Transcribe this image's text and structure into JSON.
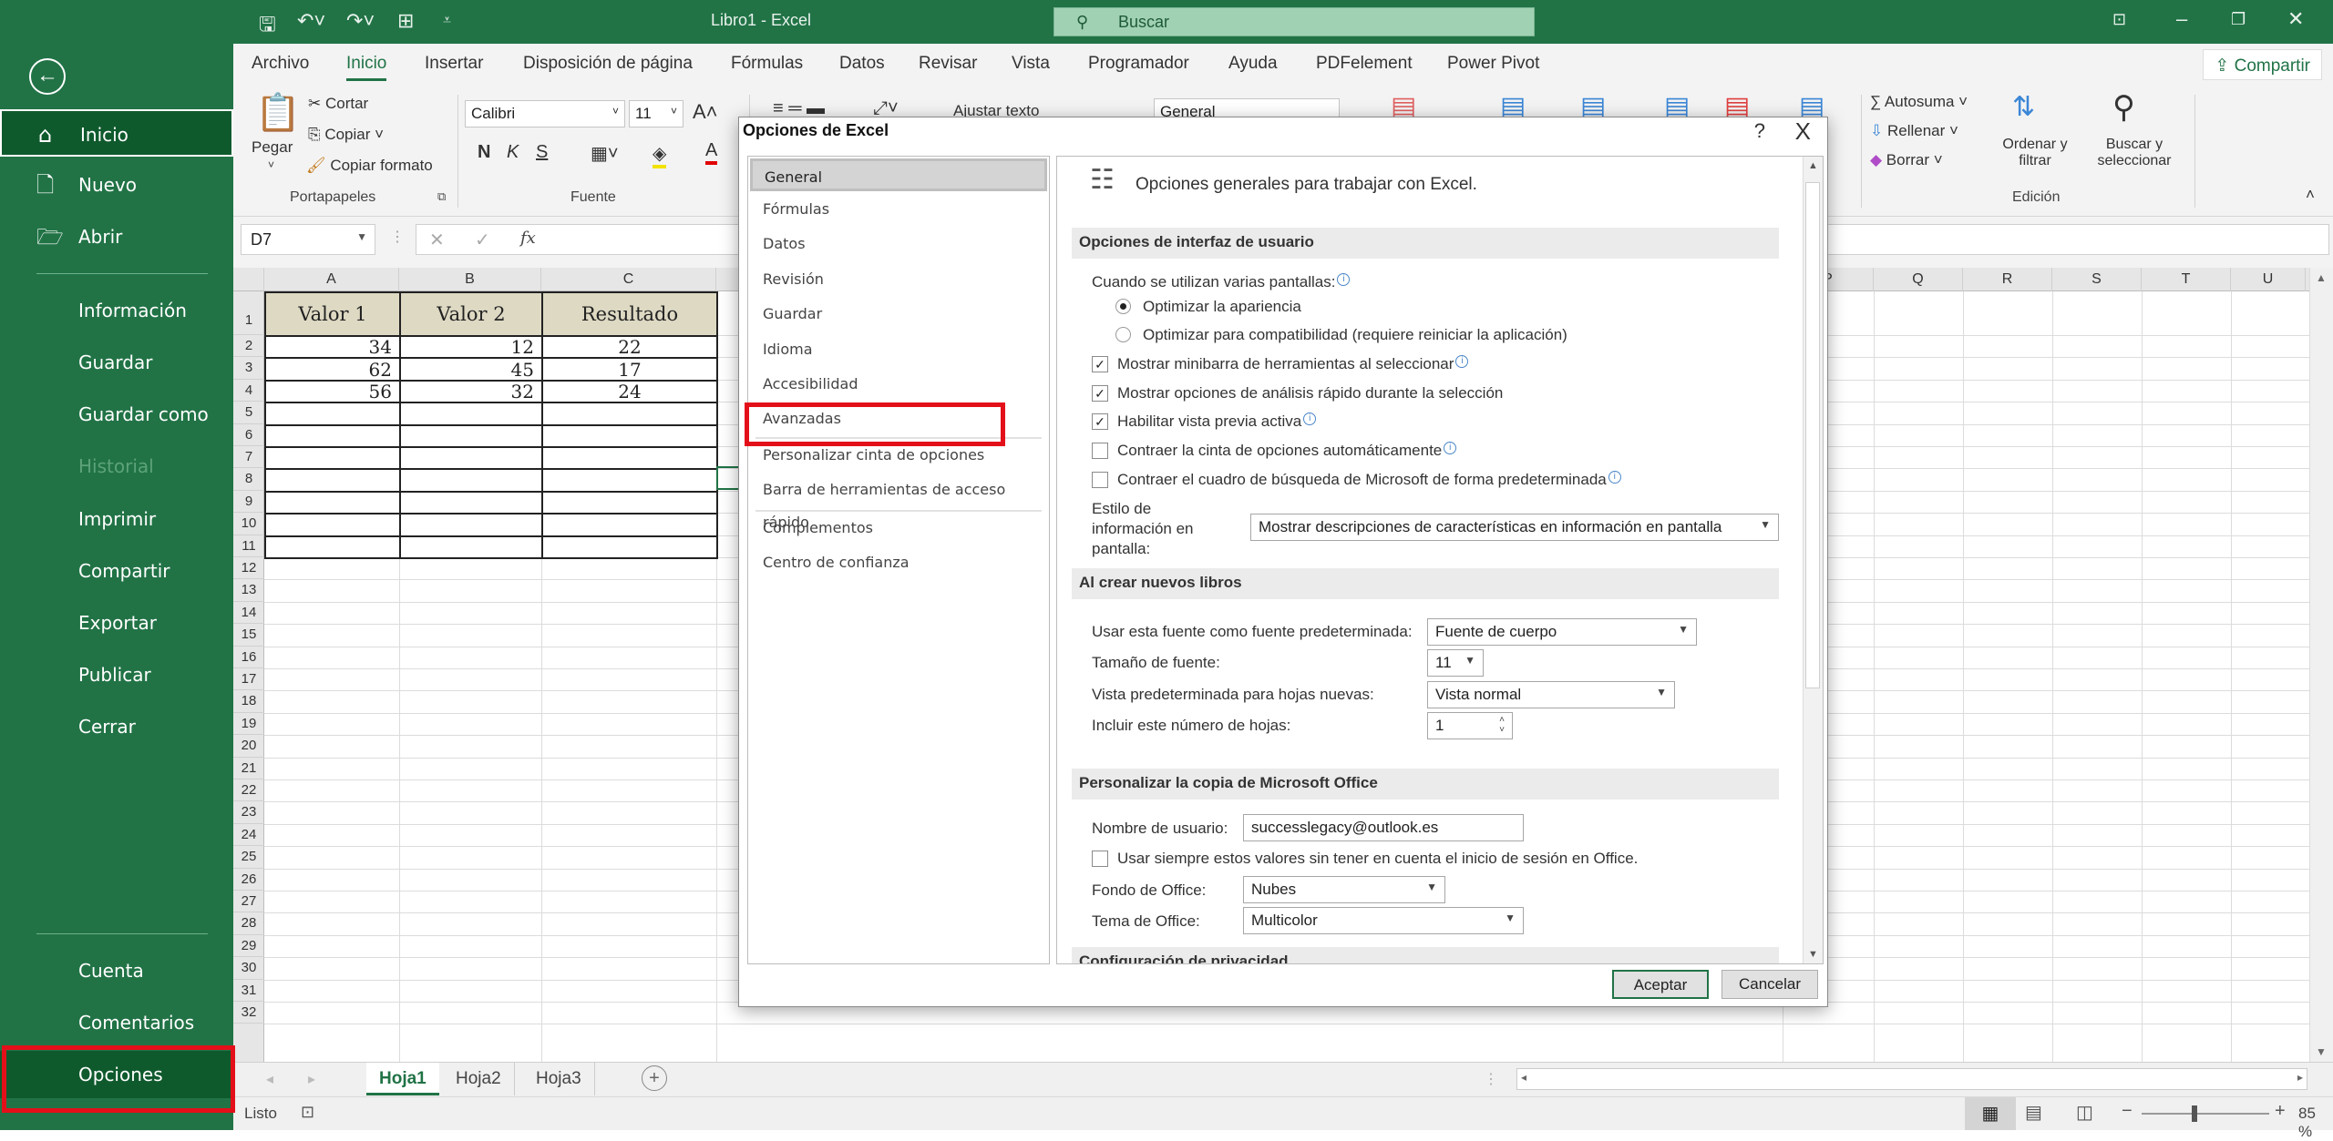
{
  "window": {
    "title": "Libro1  -  Excel",
    "search_placeholder": "Buscar",
    "qat": {
      "save": "save-icon",
      "undo": "undo-icon",
      "redo": "redo-icon",
      "table": "table-icon",
      "customize": "customize-icon"
    }
  },
  "backstage": {
    "back_icon": "back-arrow-icon",
    "top_items": [
      {
        "label": "Inicio",
        "icon": "home-icon",
        "selected": true
      },
      {
        "label": "Nuevo",
        "icon": "new-file-icon"
      },
      {
        "label": "Abrir",
        "icon": "open-folder-icon"
      }
    ],
    "items": [
      {
        "label": "Información"
      },
      {
        "label": "Guardar"
      },
      {
        "label": "Guardar como"
      },
      {
        "label": "Historial",
        "disabled": true
      },
      {
        "label": "Imprimir"
      },
      {
        "label": "Compartir"
      },
      {
        "label": "Exportar"
      },
      {
        "label": "Publicar"
      },
      {
        "label": "Cerrar"
      }
    ],
    "bottom_items": [
      {
        "label": "Cuenta"
      },
      {
        "label": "Comentarios"
      },
      {
        "label": "Opciones",
        "highlighted": true
      }
    ]
  },
  "ribbon": {
    "tabs": [
      "Archivo",
      "Inicio",
      "Insertar",
      "Disposición de página",
      "Fórmulas",
      "Datos",
      "Revisar",
      "Vista",
      "Programador",
      "Ayuda",
      "PDFelement",
      "Power Pivot"
    ],
    "active_tab": "Inicio",
    "share": "Compartir",
    "clipboard": {
      "paste": "Pegar",
      "cut": "Cortar",
      "copy": "Copiar",
      "format_painter": "Copiar formato",
      "group": "Portapapeles"
    },
    "font": {
      "name": "Calibri",
      "size": "11",
      "bold": "N",
      "italic": "K",
      "underline": "S",
      "group": "Fuente"
    },
    "alignment": {
      "wrap": "Ajustar texto"
    },
    "number": {
      "format": "General"
    },
    "editing": {
      "autosum": "Autosuma",
      "fill": "Rellenar",
      "clear": "Borrar",
      "sort": "Ordenar y filtrar",
      "find": "Buscar y seleccionar",
      "group": "Edición"
    }
  },
  "formula_bar": {
    "name_box": "D7",
    "fx": "fx",
    "value": ""
  },
  "sheet": {
    "columns_left": [
      "A",
      "B",
      "C"
    ],
    "columns_right": [
      "P",
      "Q",
      "R",
      "S",
      "T",
      "U"
    ],
    "rows": [
      "1",
      "2",
      "3",
      "4",
      "5",
      "6",
      "7",
      "8",
      "9",
      "10",
      "11",
      "12",
      "13",
      "14",
      "15",
      "16",
      "17",
      "18",
      "19",
      "20",
      "21",
      "22",
      "23",
      "24",
      "25",
      "26",
      "27",
      "28",
      "29",
      "30",
      "31",
      "32"
    ],
    "table": {
      "headers": [
        "Valor 1",
        "Valor 2",
        "Resultado"
      ],
      "rows": [
        [
          "34",
          "12",
          "22"
        ],
        [
          "62",
          "45",
          "17"
        ],
        [
          "56",
          "32",
          "24"
        ]
      ]
    },
    "selected_cell": "D7"
  },
  "sheet_tabs": {
    "tabs": [
      "Hoja1",
      "Hoja2",
      "Hoja3"
    ],
    "active": "Hoja1"
  },
  "status": {
    "text": "Listo",
    "zoom": "85 %",
    "zoom_level": 0.85
  },
  "dialog": {
    "title": "Opciones de Excel",
    "help": "?",
    "close": "X",
    "nav": [
      {
        "label": "General",
        "selected": true
      },
      {
        "label": "Fórmulas"
      },
      {
        "label": "Datos"
      },
      {
        "label": "Revisión"
      },
      {
        "label": "Guardar"
      },
      {
        "label": "Idioma"
      },
      {
        "label": "Accesibilidad"
      },
      {
        "label": "Avanzadas",
        "highlighted": true
      },
      {
        "label": "Personalizar cinta de opciones"
      },
      {
        "label": "Barra de herramientas de acceso rápido"
      },
      {
        "label": "Complementos"
      },
      {
        "label": "Centro de confianza"
      }
    ],
    "header": "Opciones generales para trabajar con Excel.",
    "sections": {
      "ui": "Opciones de interfaz de usuario",
      "new_books": "Al crear nuevos libros",
      "personalize": "Personalizar la copia de Microsoft Office",
      "privacy": "Configuración de privacidad"
    },
    "ui": {
      "multi_screen": "Cuando se utilizan varias pantallas:",
      "radio_appearance": "Optimizar la apariencia",
      "radio_compat": "Optimizar para compatibilidad (requiere reiniciar la aplicación)",
      "cb_minibar": "Mostrar minibarra de herramientas al seleccionar",
      "cb_quick": "Mostrar opciones de análisis rápido durante la selección",
      "cb_preview": "Habilitar vista previa activa",
      "cb_collapse_ribbon": "Contraer la cinta de opciones automáticamente",
      "cb_collapse_search": "Contraer el cuadro de búsqueda de Microsoft de forma predeterminada",
      "screentip_label": "Estilo de información en pantalla:",
      "screentip_value": "Mostrar descripciones de características en información en pantalla",
      "checked": {
        "minibar": true,
        "quick": true,
        "preview": true,
        "collapse_ribbon": false,
        "collapse_search": false
      },
      "radio_selected": "appearance"
    },
    "new_books": {
      "font_label": "Usar esta fuente como fuente predeterminada:",
      "font_value": "Fuente de cuerpo",
      "size_label": "Tamaño de fuente:",
      "size_value": "11",
      "view_label": "Vista predeterminada para hojas nuevas:",
      "view_value": "Vista normal",
      "sheets_label": "Incluir este número de hojas:",
      "sheets_value": "1"
    },
    "personalize": {
      "user_label": "Nombre de usuario:",
      "user_value": "successlegacy@outlook.es",
      "always_label": "Usar siempre estos valores sin tener en cuenta el inicio de sesión en Office.",
      "always_checked": false,
      "bg_label": "Fondo de Office:",
      "bg_value": "Nubes",
      "theme_label": "Tema de Office:",
      "theme_value": "Multicolor"
    },
    "ok": "Aceptar",
    "cancel": "Cancelar"
  },
  "colors": {
    "excel_green": "#217346",
    "selected_dark": "#0f5a2d",
    "highlight_red": "#e3101a",
    "table_header": "#ddd9c3"
  }
}
